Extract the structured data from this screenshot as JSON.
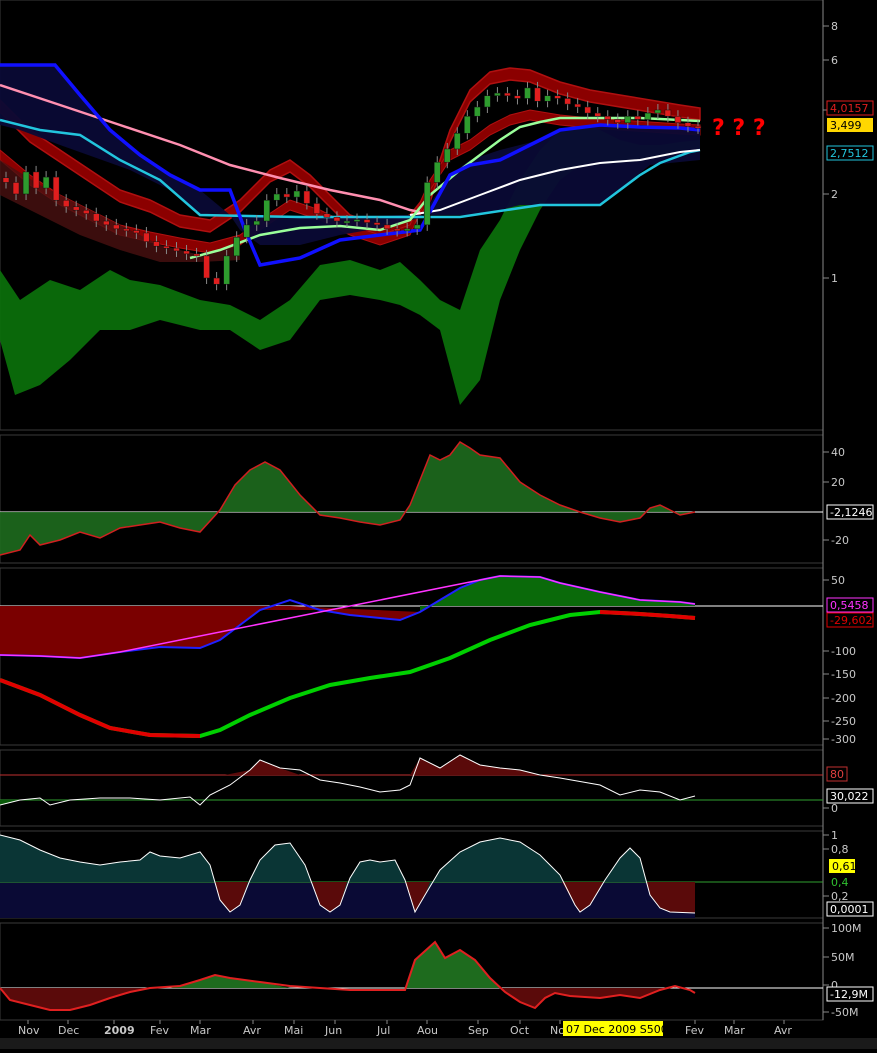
{
  "annotation": "? ? ?",
  "crosshair_label": "07 Dec 2009 S500",
  "colors": {
    "background": "#000000",
    "axis_text": "#c8c8c8",
    "up_candle": "#2e9c2e",
    "down_candle": "#e01e1e",
    "upper_band": "#8b0000",
    "lower_band": "#0b6e0b",
    "blue_line": "#1010ff",
    "cyan_line": "#22c5dd",
    "pink_line": "#ff8fb0",
    "light_green_line": "#9aff9a",
    "white_line": "#ffffff",
    "macd_green": "#0a6a0a",
    "macd_red": "#7a0000",
    "magenta": "#ff33ff",
    "bright_green": "#00d000",
    "bright_red": "#e00000",
    "dark_teal": "#0a3535",
    "dark_navy": "#0a0a35",
    "annotation_red": "#ff0000",
    "crosshair_bg": "#ffff00"
  },
  "chart_data": [
    {
      "type": "candlestick",
      "panel": "price",
      "yscale": "log",
      "yticks": [
        "8",
        "6",
        "4",
        "2",
        "1"
      ],
      "last_labels": [
        {
          "text": "4,0157",
          "color": "#e01e1e"
        },
        {
          "text": "3,499",
          "color": "#000000",
          "bg": "#ffd700"
        },
        {
          "text": "2,7512",
          "color": "#22c5dd"
        }
      ],
      "series": [
        {
          "name": "close",
          "x": [
            0,
            10,
            20,
            30,
            40,
            50,
            60,
            70,
            80,
            90,
            100,
            110,
            120,
            130,
            140,
            150,
            160,
            170,
            180,
            190,
            200,
            210,
            220,
            230,
            240,
            250,
            260,
            270,
            280,
            290,
            300,
            310,
            320,
            330,
            340,
            350,
            360,
            370,
            380,
            390,
            400,
            410,
            420,
            430,
            440,
            450,
            460,
            470,
            480,
            490,
            500,
            510,
            520,
            530,
            540,
            550,
            560,
            570,
            580,
            590,
            600,
            610,
            620,
            630,
            640,
            650,
            660,
            670,
            680,
            690
          ],
          "values": [
            2.2,
            2.0,
            2.4,
            2.1,
            2.3,
            1.9,
            1.8,
            1.75,
            1.7,
            1.6,
            1.55,
            1.5,
            1.48,
            1.45,
            1.35,
            1.3,
            1.28,
            1.25,
            1.22,
            1.2,
            1.0,
            0.95,
            1.2,
            1.4,
            1.55,
            1.6,
            1.9,
            2.0,
            1.95,
            2.05,
            1.85,
            1.7,
            1.65,
            1.6,
            1.6,
            1.62,
            1.58,
            1.55,
            1.5,
            1.48,
            1.5,
            1.55,
            2.2,
            2.6,
            2.9,
            3.3,
            3.8,
            4.1,
            4.5,
            4.6,
            4.5,
            4.4,
            4.8,
            4.3,
            4.5,
            4.4,
            4.2,
            4.1,
            3.9,
            3.8,
            3.7,
            3.6,
            3.8,
            3.7,
            3.9,
            4.0,
            3.8,
            3.6,
            3.5,
            3.45
          ]
        }
      ]
    },
    {
      "type": "line",
      "panel": "oscillator_1",
      "yticks": [
        "40",
        "20",
        "-20"
      ],
      "last_label": "-2,1246"
    },
    {
      "type": "area",
      "panel": "oscillator_2",
      "yticks": [
        "50",
        "-100",
        "-150",
        "-200",
        "-250",
        "-300"
      ],
      "last_labels": [
        "0,5458",
        "-29,602"
      ]
    },
    {
      "type": "line",
      "panel": "stochastic",
      "yticks": [
        "0"
      ],
      "last_labels": [
        "80",
        "30,022"
      ]
    },
    {
      "type": "area",
      "panel": "ratio",
      "yticks": [
        "1",
        "0,8",
        "0,2"
      ],
      "last_labels": [
        "0,61",
        "0,4",
        "0,0001"
      ]
    },
    {
      "type": "area",
      "panel": "volume_osc",
      "yticks": [
        "100M",
        "50M",
        "0",
        "-50M"
      ],
      "last_label": "-12,9M"
    }
  ],
  "x_axis_labels": [
    "Nov",
    "Dec",
    "2009",
    "Fev",
    "Mar",
    "Avr",
    "Mai",
    "Jun",
    "Jul",
    "Aou",
    "Sep",
    "Oct",
    "No",
    "S500",
    "Fev",
    "Mar",
    "Avr"
  ]
}
